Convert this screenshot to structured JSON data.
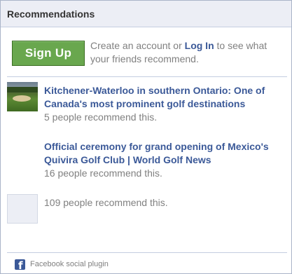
{
  "header": {
    "title": "Recommendations"
  },
  "signup": {
    "button_label": "Sign Up",
    "prompt_before": "Create an account or ",
    "login_label": "Log In",
    "prompt_after": " to see what your friends recommend."
  },
  "recommendations": [
    {
      "title": "Kitchener-Waterloo in southern Ontario: One of Canada's most prominent golf destinations",
      "count": "5 people recommend this.",
      "thumbnail": "golf-course-thumbnail"
    },
    {
      "title": "Official ceremony for grand opening of Mexico's Quivira Golf Club | World Golf News",
      "count": "16 people recommend this."
    },
    {
      "count": "109 people recommend this.",
      "thumbnail": "placeholder-thumbnail"
    }
  ],
  "footer": {
    "icon": "facebook-icon",
    "label": "Facebook social plugin"
  },
  "colors": {
    "link": "#3b5998",
    "signup_green": "#69a74e",
    "header_bg": "#eceef5",
    "muted_text": "#808080"
  }
}
